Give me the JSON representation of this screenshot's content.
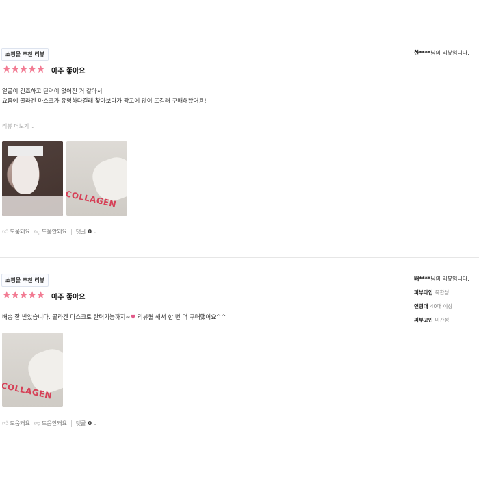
{
  "reviews": [
    {
      "badge": "쇼핑몰 추천 리뷰",
      "stars": 5,
      "rating_text": "아주 좋아요",
      "body_lines": [
        "얼굴이 건조하고 탄력이 없어진 거 같아서",
        "요즘에 콜라겐 마스크가 유명하다길래 찾아보다가 광고에 많이 뜨길래 구매해봤어용!"
      ],
      "more_label": "리뷰 더보기",
      "photos": [
        "face-photo",
        "collagen-pack-photo"
      ],
      "photo_brand_text": "COLLAGEN",
      "helpful_label": "도움돼요",
      "not_helpful_label": "도움안돼요",
      "comment_label": "댓글",
      "comment_count": "0",
      "reviewer": {
        "name": "한****",
        "suffix": "님의 리뷰입니다.",
        "attributes": []
      }
    },
    {
      "badge": "쇼핑몰 추천 리뷰",
      "stars": 5,
      "rating_text": "아주 좋아요",
      "body_before_heart": "배송 잘 받았습니다. 콜라겐 마스크로 탄력기능까지~",
      "heart": "♥",
      "body_after_heart": " 리뷰월 해서 한 번 더 구매했어요^^",
      "photos": [
        "collagen-pack-photo"
      ],
      "photo_brand_text": "COLLAGEN",
      "helpful_label": "도움돼요",
      "not_helpful_label": "도움안돼요",
      "comment_label": "댓글",
      "comment_count": "0",
      "reviewer": {
        "name": "배****",
        "suffix": "님의 리뷰입니다.",
        "attributes": [
          {
            "key": "피부타입",
            "value": "복합성"
          },
          {
            "key": "연령대",
            "value": "40대 이상"
          },
          {
            "key": "피부고민",
            "value": "미간성"
          }
        ]
      }
    }
  ],
  "colors": {
    "star": "#f27a92",
    "brand": "#d64057",
    "heart": "#e25b8a"
  },
  "icons": {
    "star": "star-icon",
    "thumb_up": "thumb-up-icon",
    "thumb_down": "thumb-down-icon",
    "chevron": "chevron-down-icon"
  }
}
